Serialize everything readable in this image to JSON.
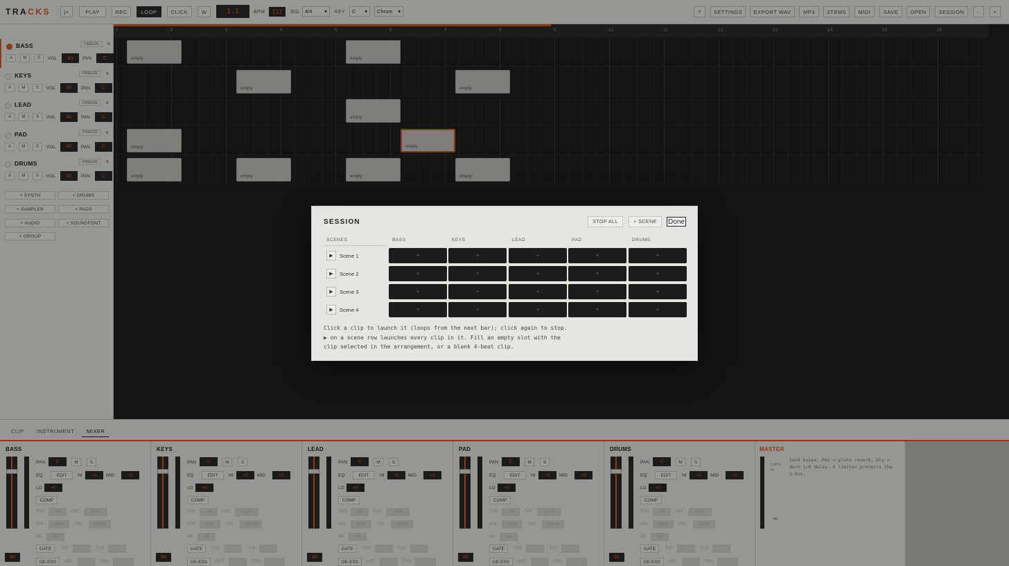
{
  "toolbar": {
    "logo_pre": "TRA",
    "logo_accent": "CKS",
    "rewind": "|<",
    "play": "PLAY",
    "rec": "REC",
    "loop": "LOOP",
    "click": "CLICK",
    "w": "W",
    "position": "1.1",
    "bpm_label": "BPM",
    "bpm": "112",
    "sig_label": "SIG",
    "sig": "4/4",
    "key_label": "KEY",
    "key": "C",
    "scale": "Chrom",
    "help": "?",
    "settings": "SETTINGS",
    "export_wav": "EXPORT WAV",
    "mp3": "MP3",
    "stems": "STEMS",
    "midi": "MIDI",
    "save": "SAVE",
    "open": "OPEN",
    "session": "SESSION",
    "zoom_out": "-",
    "zoom_in": "+"
  },
  "tracks": [
    {
      "name": "BASS",
      "armed": true,
      "vol": "80",
      "pan": "C"
    },
    {
      "name": "KEYS",
      "armed": false,
      "vol": "80",
      "pan": "C"
    },
    {
      "name": "LEAD",
      "armed": false,
      "vol": "80",
      "pan": "C"
    },
    {
      "name": "PAD",
      "armed": false,
      "vol": "80",
      "pan": "C"
    },
    {
      "name": "DRUMS",
      "armed": false,
      "vol": "80",
      "pan": "C"
    }
  ],
  "track_labels": {
    "freeze": "FREEZE",
    "close": "x",
    "a": "A",
    "m": "M",
    "s": "S",
    "vol": "VOL",
    "pan": "PAN"
  },
  "add_buttons": [
    "+ SYNTH",
    "+ DRUMS",
    "+ SAMPLER",
    "+ PADS",
    "+ AUDIO",
    "+ SOUNDFONT",
    "+ GROUP"
  ],
  "ruler": [
    "1",
    "2",
    "3",
    "4",
    "5",
    "6",
    "7",
    "8",
    "9",
    "10",
    "11",
    "12",
    "13",
    "14",
    "15",
    "16"
  ],
  "clip_label": "empty",
  "bottom_tabs": [
    "CLIP",
    "INSTRUMENT",
    "MIXER"
  ],
  "mixer": {
    "strips": [
      "BASS",
      "KEYS",
      "LEAD",
      "PAD",
      "DRUMS"
    ],
    "vol": "80",
    "pan_label": "PAN",
    "pan": "C",
    "m": "M",
    "s": "S",
    "eq": "EQ",
    "edit": "EDIT",
    "hi": "HI",
    "mid": "MID",
    "lo": "LO",
    "gain": "+0",
    "comp": "COMP",
    "thr": "THR",
    "thr_val": "-18",
    "rat": "RAT",
    "rat_val": "3.0:1",
    "atk": "ATK",
    "atk_val": "10ms",
    "rel": "REL",
    "rel_val": "150ms",
    "mk": "MK",
    "mk_val": "+0",
    "gate": "GATE",
    "gthr": "THR",
    "gthr_val": "-",
    "flr": "FLR",
    "flr_val": "-",
    "deess": "DE-ESS",
    "amt": "AMT",
    "amt_val": "-",
    "frq": "FRQ",
    "frq_val": "-"
  },
  "master": {
    "name": "MASTER",
    "lufs": "LUFS-M",
    "inf": "-∞",
    "note": "Send buses: Rev = plate reverb, Dly = dark 1/8 delay. A limiter protects the 2-bus."
  },
  "session": {
    "title": "SESSION",
    "stop_all": "STOP ALL",
    "add_scene": "+ SCENE",
    "done": "Done",
    "scenes_header": "SCENES",
    "columns": [
      "BASS",
      "KEYS",
      "LEAD",
      "PAD",
      "DRUMS"
    ],
    "scenes": [
      "Scene 1",
      "Scene 2",
      "Scene 3",
      "Scene 4"
    ],
    "slot": "+",
    "play": "▶",
    "help": "Click a clip to launch it (loops from the next bar); click again to stop. ▶ on a scene row launches every clip in it. Fill an empty slot with the clip selected in the arrangement, or a blank 4-beat clip."
  }
}
